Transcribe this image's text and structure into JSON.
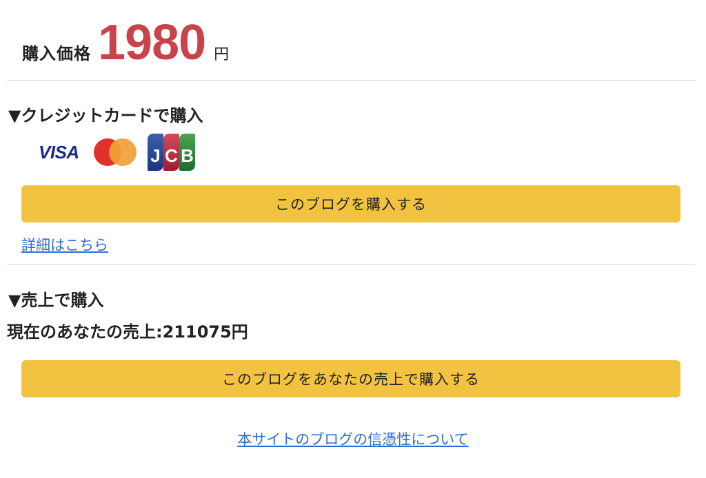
{
  "price": {
    "label": "購入価格",
    "amount": "1980",
    "unit": "円",
    "amount_color": "#c8434a"
  },
  "credit_card": {
    "heading": "▼クレジットカードで購入",
    "brands": {
      "visa": "VISA",
      "mastercard_icon": "mastercard-icon",
      "jcb": [
        "J",
        "C",
        "B"
      ]
    },
    "buy_button": "このブログを購入する",
    "details_link": "詳細はこちら"
  },
  "sales": {
    "heading": "▼売上で購入",
    "current_sales_text": "現在のあなたの売上:211075円",
    "buy_button": "このブログをあなたの売上で購入する"
  },
  "footer": {
    "trust_link": "本サイトのブログの信憑性について"
  },
  "colors": {
    "button_bg": "#f2c340",
    "link": "#2d6fd0"
  }
}
